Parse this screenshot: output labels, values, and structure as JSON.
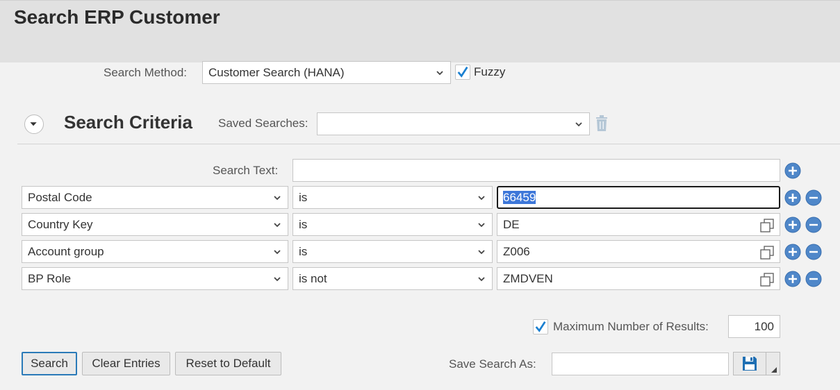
{
  "header": {
    "title": "Search ERP Customer"
  },
  "search_method": {
    "label": "Search Method:",
    "value": "Customer Search (HANA)",
    "fuzzy_label": "Fuzzy",
    "fuzzy_checked": true
  },
  "criteria": {
    "title": "Search Criteria",
    "saved_searches_label": "Saved Searches:",
    "saved_searches_value": "",
    "search_text_label": "Search Text:",
    "search_text_value": "",
    "rows": [
      {
        "field": "Postal Code",
        "operator": "is",
        "value": "66459"
      },
      {
        "field": "Country Key",
        "operator": "is",
        "value": "DE"
      },
      {
        "field": "Account group",
        "operator": "is",
        "value": "Z006"
      },
      {
        "field": "BP Role",
        "operator": "is not",
        "value": "ZMDVEN"
      }
    ]
  },
  "max_results": {
    "label": "Maximum Number of Results:",
    "checked": true,
    "value": "100"
  },
  "actions": {
    "search": "Search",
    "clear": "Clear Entries",
    "reset": "Reset to Default",
    "save_as_label": "Save Search As:",
    "save_as_value": ""
  },
  "colors": {
    "accent": "#2a7ab8",
    "checkmark": "#1a7fd0",
    "circle": "#4f87c9"
  },
  "icons": [
    "chevron-down-icon",
    "collapse-arrow-icon",
    "trash-icon",
    "add-icon",
    "remove-icon",
    "copy-icon",
    "checkmark-icon",
    "save-icon"
  ]
}
